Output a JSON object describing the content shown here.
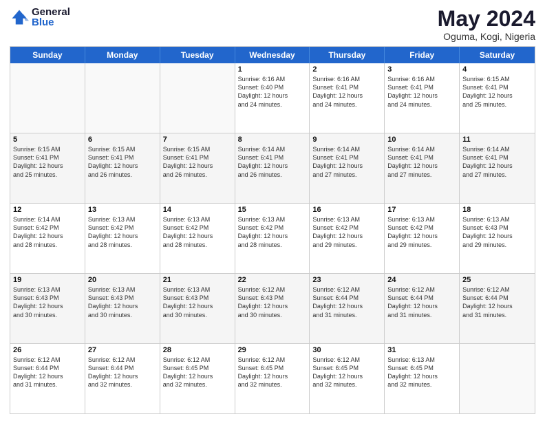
{
  "logo": {
    "general": "General",
    "blue": "Blue"
  },
  "title": {
    "month": "May 2024",
    "location": "Oguma, Kogi, Nigeria"
  },
  "weekdays": [
    "Sunday",
    "Monday",
    "Tuesday",
    "Wednesday",
    "Thursday",
    "Friday",
    "Saturday"
  ],
  "rows": [
    [
      {
        "day": "",
        "info": "",
        "empty": true
      },
      {
        "day": "",
        "info": "",
        "empty": true
      },
      {
        "day": "",
        "info": "",
        "empty": true
      },
      {
        "day": "1",
        "info": "Sunrise: 6:16 AM\nSunset: 6:40 PM\nDaylight: 12 hours\nand 24 minutes."
      },
      {
        "day": "2",
        "info": "Sunrise: 6:16 AM\nSunset: 6:41 PM\nDaylight: 12 hours\nand 24 minutes."
      },
      {
        "day": "3",
        "info": "Sunrise: 6:16 AM\nSunset: 6:41 PM\nDaylight: 12 hours\nand 24 minutes."
      },
      {
        "day": "4",
        "info": "Sunrise: 6:15 AM\nSunset: 6:41 PM\nDaylight: 12 hours\nand 25 minutes."
      }
    ],
    [
      {
        "day": "5",
        "info": "Sunrise: 6:15 AM\nSunset: 6:41 PM\nDaylight: 12 hours\nand 25 minutes."
      },
      {
        "day": "6",
        "info": "Sunrise: 6:15 AM\nSunset: 6:41 PM\nDaylight: 12 hours\nand 26 minutes."
      },
      {
        "day": "7",
        "info": "Sunrise: 6:15 AM\nSunset: 6:41 PM\nDaylight: 12 hours\nand 26 minutes."
      },
      {
        "day": "8",
        "info": "Sunrise: 6:14 AM\nSunset: 6:41 PM\nDaylight: 12 hours\nand 26 minutes."
      },
      {
        "day": "9",
        "info": "Sunrise: 6:14 AM\nSunset: 6:41 PM\nDaylight: 12 hours\nand 27 minutes."
      },
      {
        "day": "10",
        "info": "Sunrise: 6:14 AM\nSunset: 6:41 PM\nDaylight: 12 hours\nand 27 minutes."
      },
      {
        "day": "11",
        "info": "Sunrise: 6:14 AM\nSunset: 6:41 PM\nDaylight: 12 hours\nand 27 minutes."
      }
    ],
    [
      {
        "day": "12",
        "info": "Sunrise: 6:14 AM\nSunset: 6:42 PM\nDaylight: 12 hours\nand 28 minutes."
      },
      {
        "day": "13",
        "info": "Sunrise: 6:13 AM\nSunset: 6:42 PM\nDaylight: 12 hours\nand 28 minutes."
      },
      {
        "day": "14",
        "info": "Sunrise: 6:13 AM\nSunset: 6:42 PM\nDaylight: 12 hours\nand 28 minutes."
      },
      {
        "day": "15",
        "info": "Sunrise: 6:13 AM\nSunset: 6:42 PM\nDaylight: 12 hours\nand 28 minutes."
      },
      {
        "day": "16",
        "info": "Sunrise: 6:13 AM\nSunset: 6:42 PM\nDaylight: 12 hours\nand 29 minutes."
      },
      {
        "day": "17",
        "info": "Sunrise: 6:13 AM\nSunset: 6:42 PM\nDaylight: 12 hours\nand 29 minutes."
      },
      {
        "day": "18",
        "info": "Sunrise: 6:13 AM\nSunset: 6:43 PM\nDaylight: 12 hours\nand 29 minutes."
      }
    ],
    [
      {
        "day": "19",
        "info": "Sunrise: 6:13 AM\nSunset: 6:43 PM\nDaylight: 12 hours\nand 30 minutes."
      },
      {
        "day": "20",
        "info": "Sunrise: 6:13 AM\nSunset: 6:43 PM\nDaylight: 12 hours\nand 30 minutes."
      },
      {
        "day": "21",
        "info": "Sunrise: 6:13 AM\nSunset: 6:43 PM\nDaylight: 12 hours\nand 30 minutes."
      },
      {
        "day": "22",
        "info": "Sunrise: 6:12 AM\nSunset: 6:43 PM\nDaylight: 12 hours\nand 30 minutes."
      },
      {
        "day": "23",
        "info": "Sunrise: 6:12 AM\nSunset: 6:44 PM\nDaylight: 12 hours\nand 31 minutes."
      },
      {
        "day": "24",
        "info": "Sunrise: 6:12 AM\nSunset: 6:44 PM\nDaylight: 12 hours\nand 31 minutes."
      },
      {
        "day": "25",
        "info": "Sunrise: 6:12 AM\nSunset: 6:44 PM\nDaylight: 12 hours\nand 31 minutes."
      }
    ],
    [
      {
        "day": "26",
        "info": "Sunrise: 6:12 AM\nSunset: 6:44 PM\nDaylight: 12 hours\nand 31 minutes."
      },
      {
        "day": "27",
        "info": "Sunrise: 6:12 AM\nSunset: 6:44 PM\nDaylight: 12 hours\nand 32 minutes."
      },
      {
        "day": "28",
        "info": "Sunrise: 6:12 AM\nSunset: 6:45 PM\nDaylight: 12 hours\nand 32 minutes."
      },
      {
        "day": "29",
        "info": "Sunrise: 6:12 AM\nSunset: 6:45 PM\nDaylight: 12 hours\nand 32 minutes."
      },
      {
        "day": "30",
        "info": "Sunrise: 6:12 AM\nSunset: 6:45 PM\nDaylight: 12 hours\nand 32 minutes."
      },
      {
        "day": "31",
        "info": "Sunrise: 6:13 AM\nSunset: 6:45 PM\nDaylight: 12 hours\nand 32 minutes."
      },
      {
        "day": "",
        "info": "",
        "empty": true
      }
    ]
  ]
}
